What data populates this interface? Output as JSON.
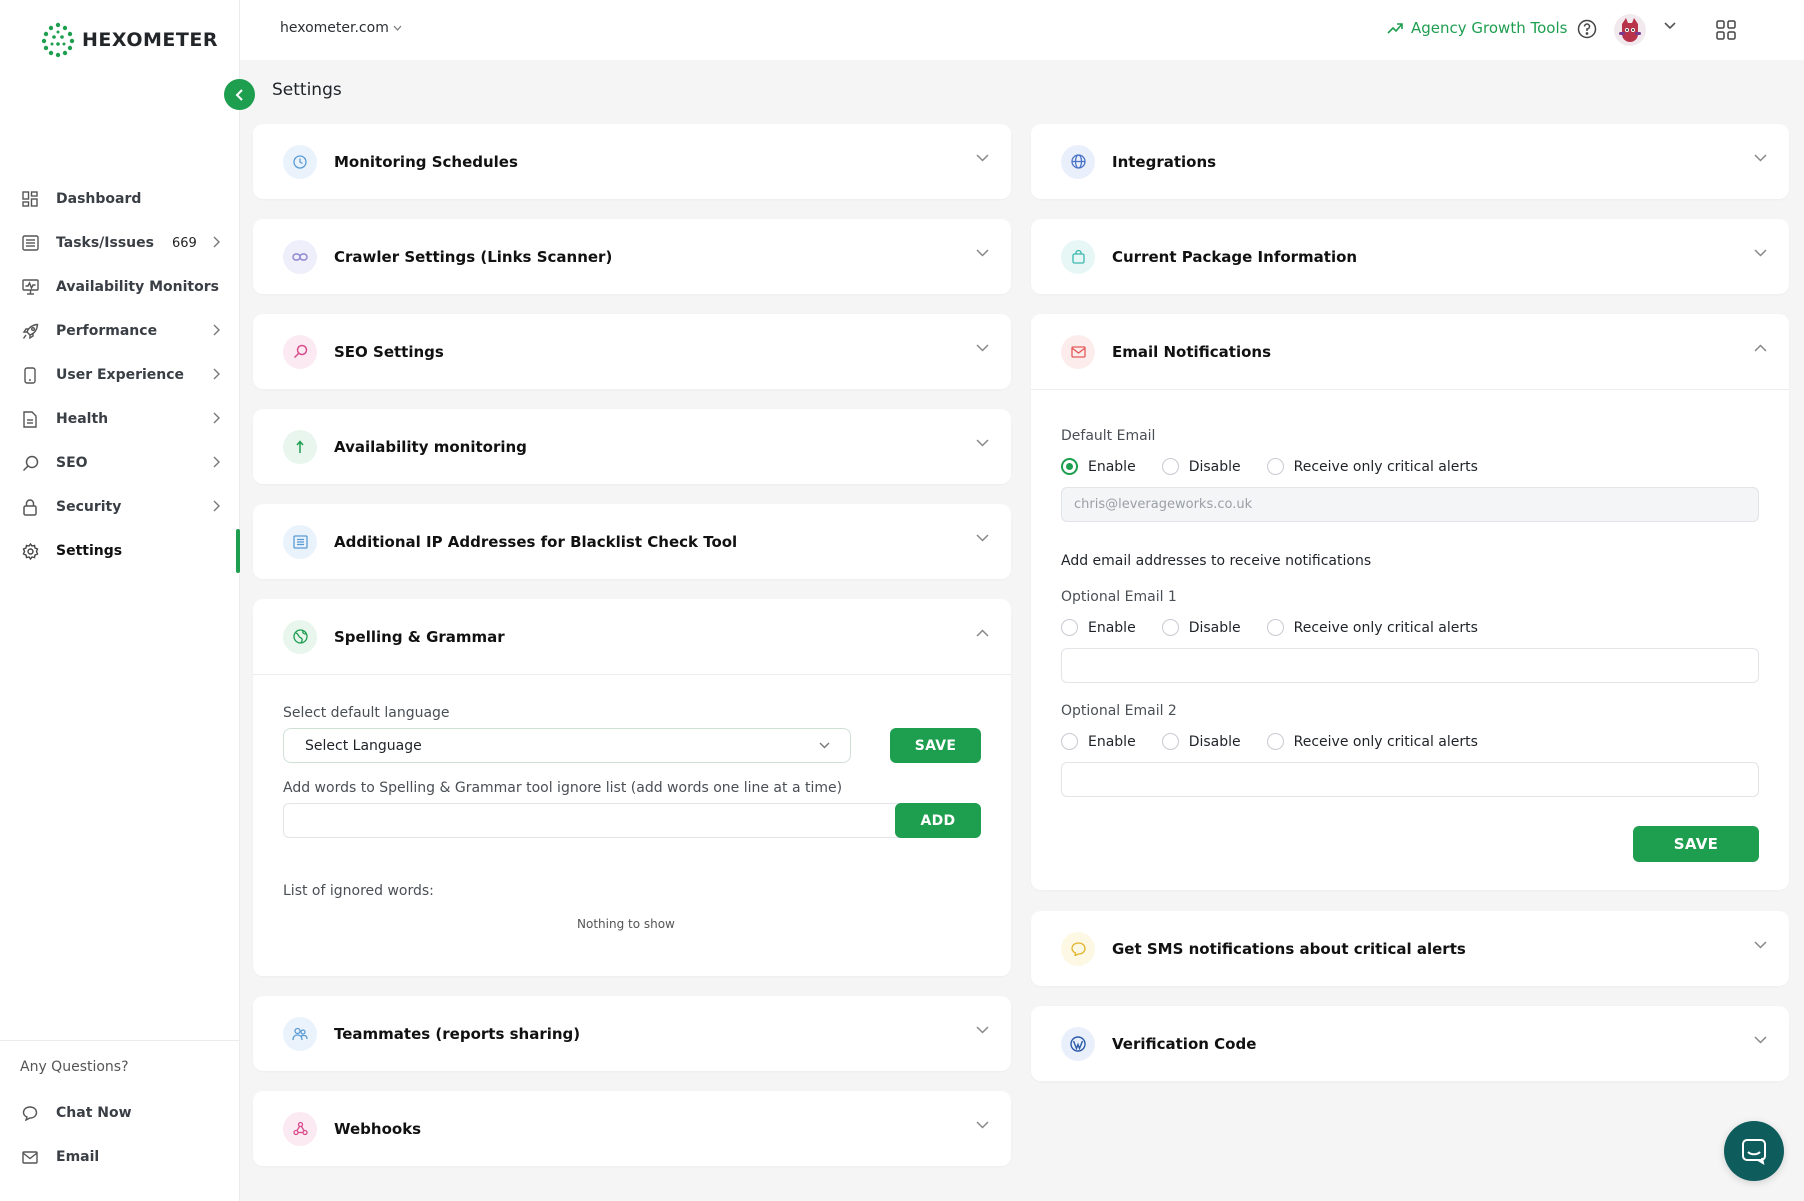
{
  "brand": {
    "name": "HEXOMETER",
    "accent": "#1e9e4f"
  },
  "topbar": {
    "domain": "hexometer.com",
    "agency_label": "Agency Growth Tools"
  },
  "page": {
    "title": "Settings"
  },
  "sidebar": {
    "items": [
      {
        "label": "Dashboard",
        "icon": "dashboard-icon"
      },
      {
        "label": "Tasks/Issues",
        "count": "669",
        "icon": "list-icon"
      },
      {
        "label": "Availability Monitors",
        "icon": "monitor-icon"
      },
      {
        "label": "Performance",
        "icon": "rocket-icon"
      },
      {
        "label": "User Experience",
        "icon": "phone-icon"
      },
      {
        "label": "Health",
        "icon": "document-icon"
      },
      {
        "label": "SEO",
        "icon": "search-icon"
      },
      {
        "label": "Security",
        "icon": "lock-icon"
      },
      {
        "label": "Settings",
        "icon": "gear-icon"
      }
    ],
    "bottom": {
      "question": "Any Questions?",
      "chat": "Chat Now",
      "email": "Email"
    }
  },
  "left_cards": {
    "monitoring": "Monitoring Schedules",
    "crawler": "Crawler Settings (Links Scanner)",
    "seo": "SEO Settings",
    "availability": "Availability monitoring",
    "ip": "Additional IP Addresses for Blacklist Check Tool",
    "spelling": {
      "title": "Spelling & Grammar",
      "select_label": "Select default language",
      "select_value": "Select Language",
      "save": "SAVE",
      "ignore_label": "Add words to Spelling & Grammar tool ignore list (add words one line at a time)",
      "add": "ADD",
      "list_label": "List of ignored words:",
      "empty": "Nothing to show"
    },
    "teammates": "Teammates (reports sharing)",
    "webhooks": "Webhooks"
  },
  "right_cards": {
    "integrations": "Integrations",
    "package": "Current Package Information",
    "email": {
      "title": "Email Notifications",
      "default_label": "Default Email",
      "default_value": "chris@leverageworks.co.uk",
      "add_label": "Add email addresses to receive notifications",
      "opt1_label": "Optional Email 1",
      "opt2_label": "Optional Email 2",
      "enable": "Enable",
      "disable": "Disable",
      "critical": "Receive only critical alerts",
      "save": "SAVE"
    },
    "sms": "Get SMS notifications about critical alerts",
    "verification": "Verification Code"
  }
}
